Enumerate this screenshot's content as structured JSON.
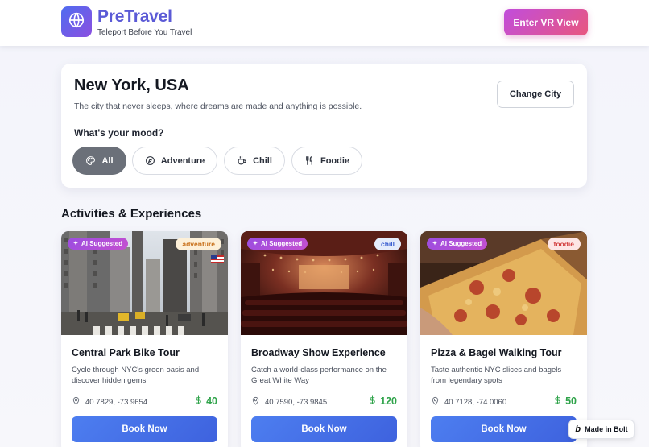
{
  "header": {
    "brand_title": "PreTravel",
    "brand_tagline": "Teleport Before You Travel",
    "vr_button_label": "Enter VR View",
    "logo_icon": "globe-icon"
  },
  "city": {
    "name": "New York, USA",
    "description": "The city that never sleeps, where dreams are made and anything is possible.",
    "change_city_label": "Change City",
    "mood_label": "What's your mood?",
    "moods": [
      {
        "label": "All",
        "icon": "palette-icon",
        "active": true
      },
      {
        "label": "Adventure",
        "icon": "compass-icon",
        "active": false
      },
      {
        "label": "Chill",
        "icon": "coffee-icon",
        "active": false
      },
      {
        "label": "Foodie",
        "icon": "utensils-icon",
        "active": false
      }
    ]
  },
  "activities": {
    "section_title": "Activities & Experiences",
    "items": [
      {
        "ai_badge": "AI Suggested",
        "tag": "adventure",
        "title": "Central Park Bike Tour",
        "description": "Cycle through NYC's green oasis and discover hidden gems",
        "coords": "40.7829, -73.9654",
        "price": "40",
        "button": "Book Now"
      },
      {
        "ai_badge": "AI Suggested",
        "tag": "chill",
        "title": "Broadway Show Experience",
        "description": "Catch a world-class performance on the Great White Way",
        "coords": "40.7590, -73.9845",
        "price": "120",
        "button": "Book Now"
      },
      {
        "ai_badge": "AI Suggested",
        "tag": "foodie",
        "title": "Pizza & Bagel Walking Tour",
        "description": "Taste authentic NYC slices and bagels from legendary spots",
        "coords": "40.7128, -74.0060",
        "price": "50",
        "button": "Book Now"
      }
    ]
  },
  "bolt_badge": {
    "logo": "b",
    "label": "Made in Bolt"
  },
  "colors": {
    "brand": "#5b5ad6",
    "vr_gradient_start": "#c14ddc",
    "vr_gradient_end": "#e8577f",
    "book_button": "#4d7ef0",
    "price": "#2fa34a",
    "active_chip": "#6b7079"
  }
}
